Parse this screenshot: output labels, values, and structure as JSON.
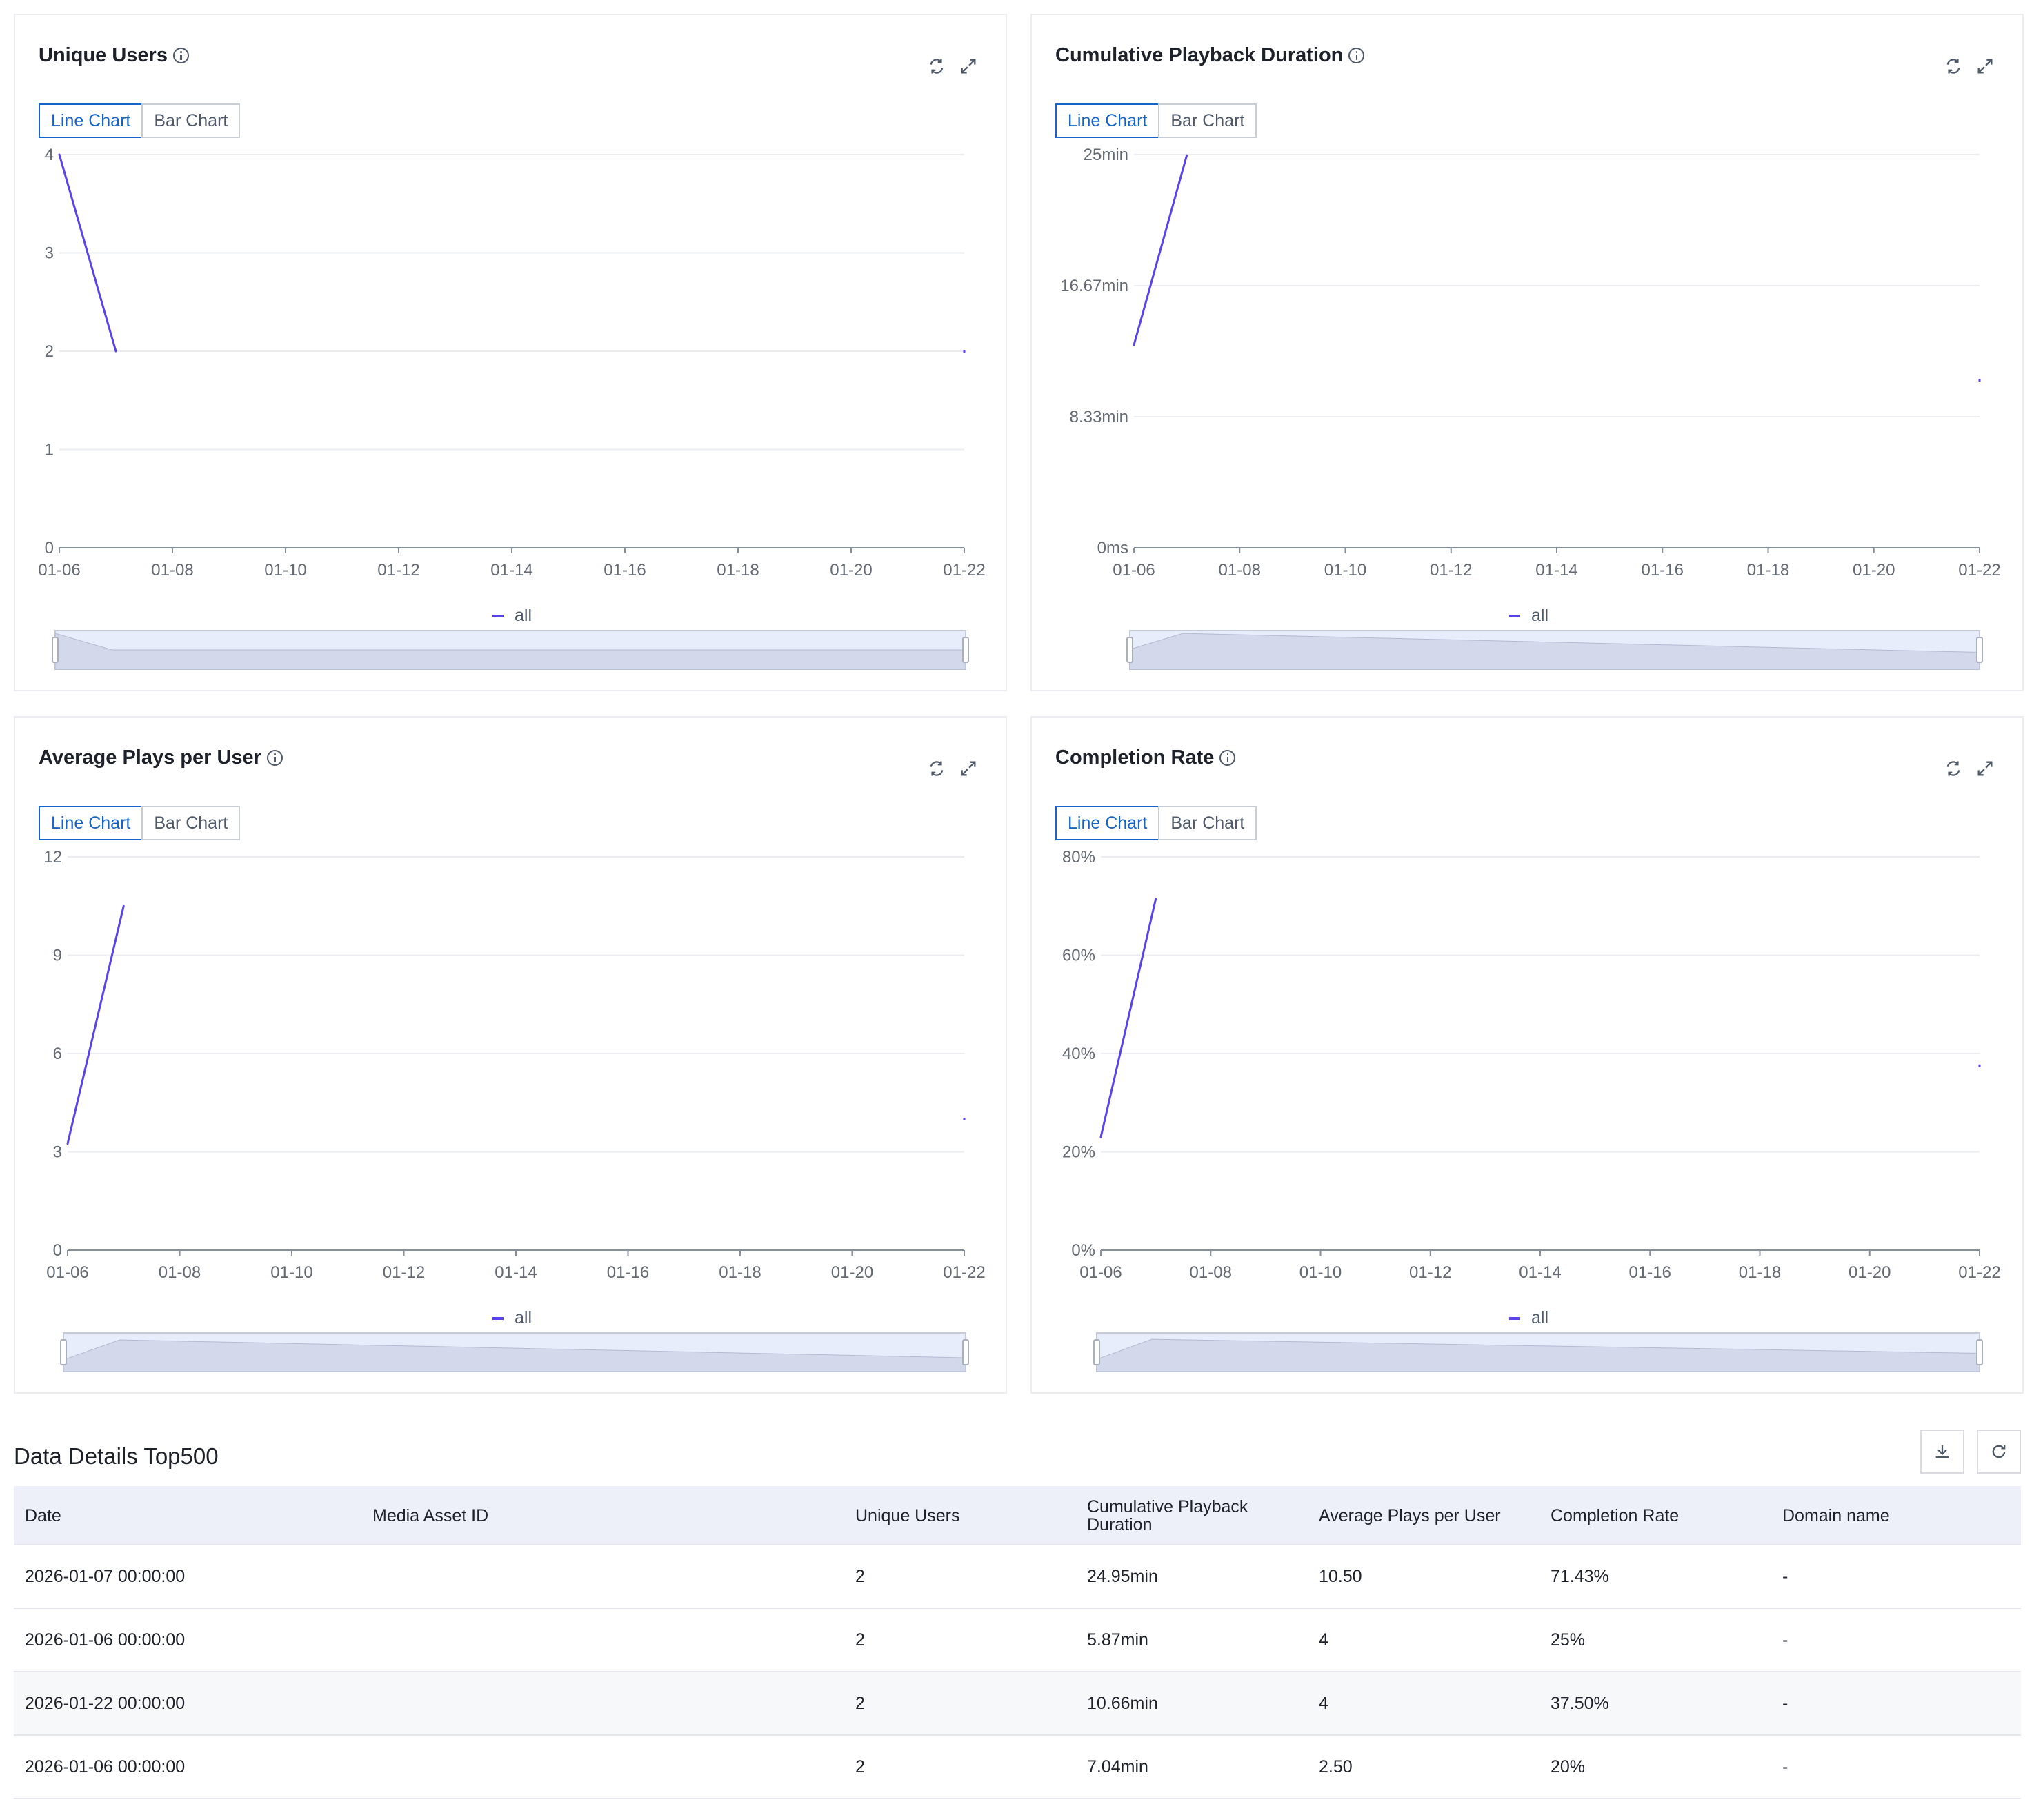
{
  "toggle": {
    "line_label": "Line Chart",
    "bar_label": "Bar Chart"
  },
  "cards": [
    {
      "title": "Unique Users"
    },
    {
      "title": "Cumulative Playback Duration"
    },
    {
      "title": "Average Plays per User"
    },
    {
      "title": "Completion Rate"
    }
  ],
  "chart_data": [
    {
      "type": "line",
      "title": "Unique Users",
      "x_tick_labels": [
        "01-06",
        "01-08",
        "01-10",
        "01-12",
        "01-14",
        "01-16",
        "01-18",
        "01-20",
        "01-22"
      ],
      "y_tick_labels": [
        "0",
        "1",
        "2",
        "3",
        "4"
      ],
      "ylim": [
        0,
        4
      ],
      "x_domain": [
        "01-06",
        "01-22"
      ],
      "series": [
        {
          "name": "all",
          "color": "#5843ee",
          "x": [
            "01-06",
            "01-07",
            "01-22"
          ],
          "y": [
            4,
            2,
            2
          ]
        }
      ],
      "legend": "bottom-center",
      "grid": true,
      "slider": true
    },
    {
      "type": "line",
      "title": "Cumulative Playback Duration",
      "x_tick_labels": [
        "01-06",
        "01-08",
        "01-10",
        "01-12",
        "01-14",
        "01-16",
        "01-18",
        "01-20",
        "01-22"
      ],
      "y_tick_labels": [
        "0ms",
        "8.33min",
        "16.67min",
        "25min"
      ],
      "ylim": [
        0,
        25
      ],
      "y_unit": "min",
      "x_domain": [
        "01-06",
        "01-22"
      ],
      "series": [
        {
          "name": "all",
          "color": "#5843ee",
          "x": [
            "01-06",
            "01-07",
            "01-22"
          ],
          "y": [
            12.9,
            24.95,
            10.66
          ]
        }
      ],
      "legend": "bottom-center",
      "grid": true,
      "slider": true
    },
    {
      "type": "line",
      "title": "Average Plays per User",
      "x_tick_labels": [
        "01-06",
        "01-08",
        "01-10",
        "01-12",
        "01-14",
        "01-16",
        "01-18",
        "01-20",
        "01-22"
      ],
      "y_tick_labels": [
        "0",
        "3",
        "6",
        "9",
        "12"
      ],
      "ylim": [
        0,
        12
      ],
      "x_domain": [
        "01-06",
        "01-22"
      ],
      "series": [
        {
          "name": "all",
          "color": "#5843ee",
          "x": [
            "01-06",
            "01-07",
            "01-22"
          ],
          "y": [
            3.25,
            10.5,
            4
          ]
        }
      ],
      "legend": "bottom-center",
      "grid": true,
      "slider": true
    },
    {
      "type": "line",
      "title": "Completion Rate",
      "x_tick_labels": [
        "01-06",
        "01-08",
        "01-10",
        "01-12",
        "01-14",
        "01-16",
        "01-18",
        "01-20",
        "01-22"
      ],
      "y_tick_labels": [
        "0%",
        "20%",
        "40%",
        "60%",
        "80%"
      ],
      "ylim": [
        0,
        80
      ],
      "y_unit": "%",
      "x_domain": [
        "01-06",
        "01-22"
      ],
      "series": [
        {
          "name": "all",
          "color": "#5843ee",
          "x": [
            "01-06",
            "01-07",
            "01-22"
          ],
          "y": [
            23,
            71.43,
            37.5
          ]
        }
      ],
      "legend": "bottom-center",
      "grid": true,
      "slider": true
    }
  ],
  "details": {
    "title": "Data Details Top500",
    "columns": [
      "Date",
      "Media Asset ID",
      "Unique Users",
      "Cumulative Playback Duration",
      "Average Plays per User",
      "Completion Rate",
      "Domain name"
    ],
    "rows": [
      [
        "2026-01-07 00:00:00",
        "",
        "2",
        "24.95min",
        "10.50",
        "71.43%",
        "-"
      ],
      [
        "2026-01-06 00:00:00",
        "",
        "2",
        "5.87min",
        "4",
        "25%",
        "-"
      ],
      [
        "2026-01-22 00:00:00",
        "",
        "2",
        "10.66min",
        "4",
        "37.50%",
        "-"
      ],
      [
        "2026-01-06 00:00:00",
        "",
        "2",
        "7.04min",
        "2.50",
        "20%",
        "-"
      ]
    ]
  }
}
